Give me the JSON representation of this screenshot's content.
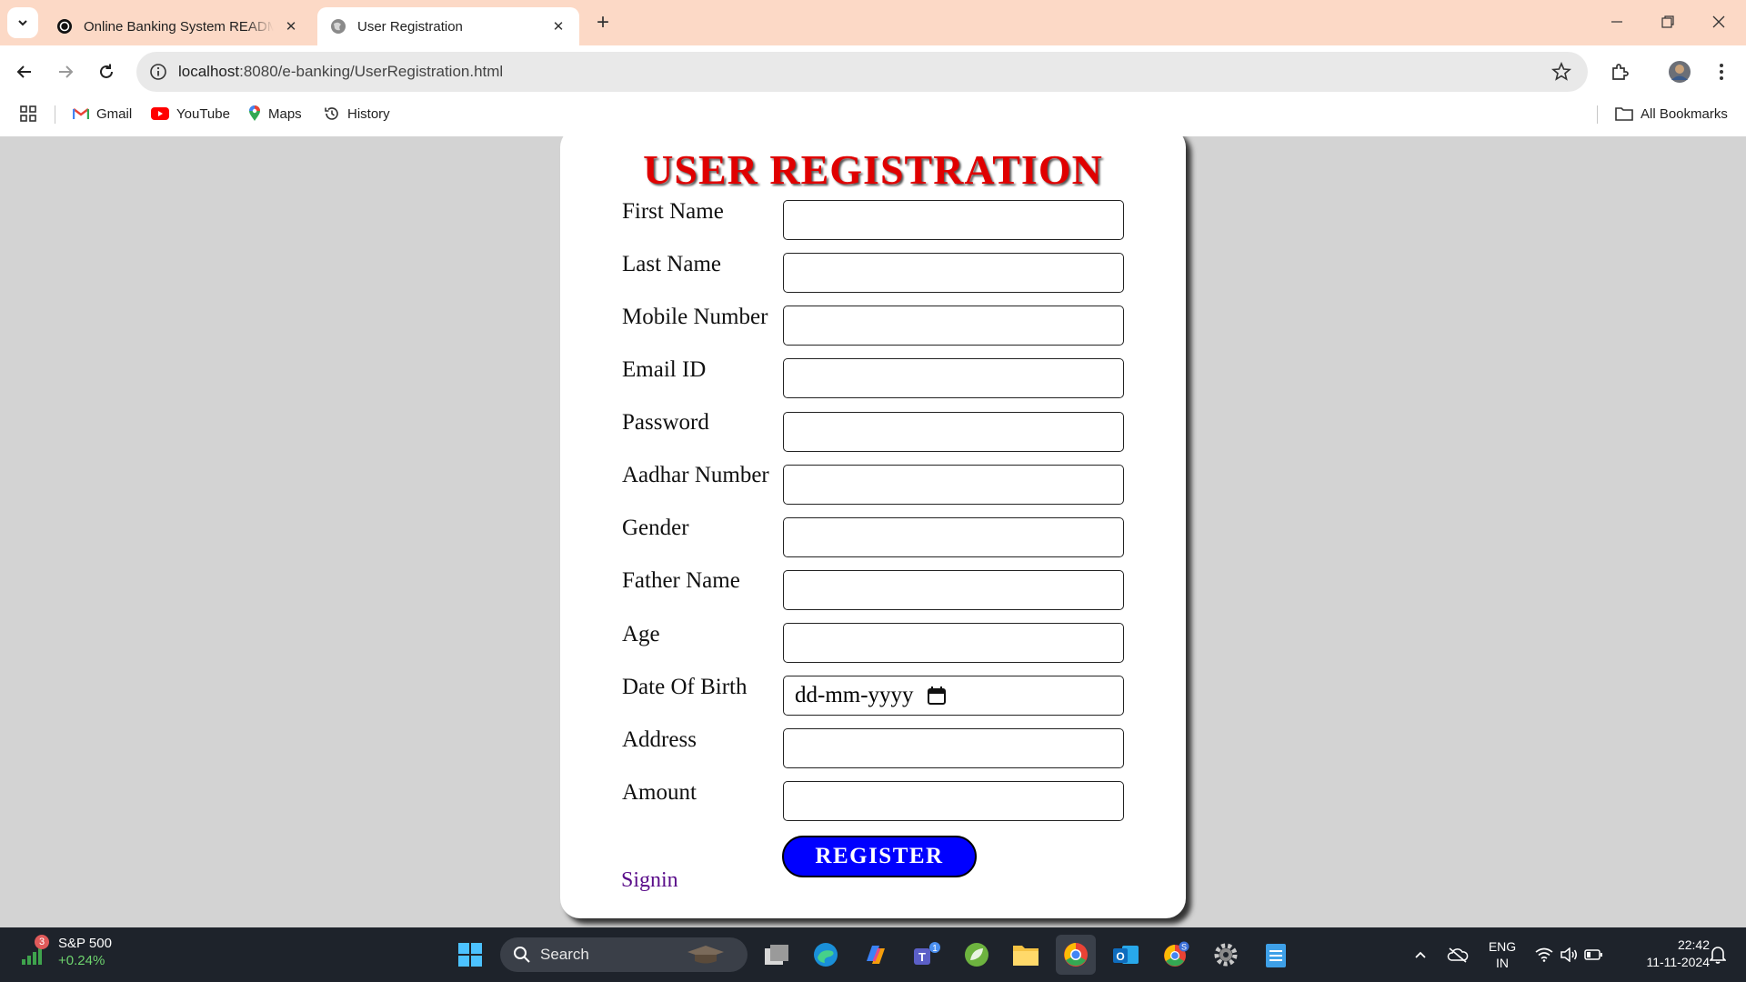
{
  "browser": {
    "tabs": [
      {
        "title": "Online Banking System README",
        "active": false
      },
      {
        "title": "User Registration",
        "active": true
      }
    ],
    "url_host": "localhost",
    "url_path": ":8080/e-banking/UserRegistration.html",
    "bookmarks": [
      "Gmail",
      "YouTube",
      "Maps",
      "History"
    ],
    "all_bookmarks": "All Bookmarks"
  },
  "form": {
    "title": "USER REGISTRATION",
    "fields": [
      {
        "label": "First Name",
        "value": ""
      },
      {
        "label": "Last Name",
        "value": ""
      },
      {
        "label": "Mobile Number",
        "value": ""
      },
      {
        "label": "Email ID",
        "value": ""
      },
      {
        "label": "Password",
        "value": ""
      },
      {
        "label": "Aadhar Number",
        "value": ""
      },
      {
        "label": "Gender",
        "value": ""
      },
      {
        "label": "Father Name",
        "value": ""
      },
      {
        "label": "Age",
        "value": ""
      },
      {
        "label": "Date Of Birth",
        "value": "dd-mm-yyyy"
      },
      {
        "label": "Address",
        "value": ""
      },
      {
        "label": "Amount",
        "value": ""
      }
    ],
    "register_label": "REGISTER",
    "signin_label": "Signin"
  },
  "colors": {
    "title": "#e00000",
    "register_bg": "#0000ff",
    "link": "#5a0d8a",
    "tabstrip": "#fcd9c6"
  },
  "taskbar": {
    "widget_badge": "3",
    "widget_title": "S&P 500",
    "widget_change": "+0.24%",
    "search_label": "Search",
    "lang_top": "ENG",
    "lang_bottom": "IN",
    "time": "22:42",
    "date": "11-11-2024"
  }
}
